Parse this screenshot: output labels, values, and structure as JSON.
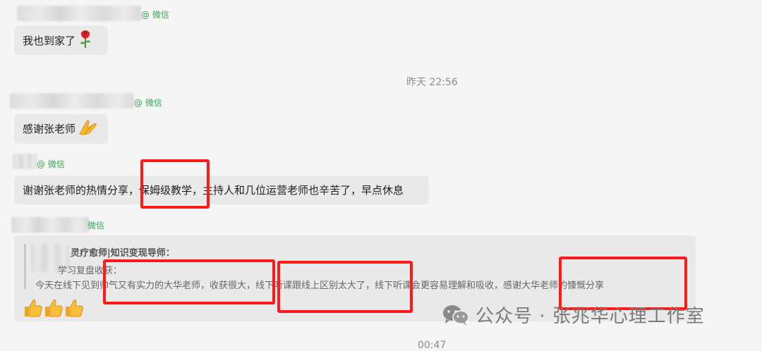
{
  "messages": [
    {
      "sender_tag": "@ 微信",
      "text": "我也到家了",
      "emoji": "rose-emoji"
    },
    {
      "sender_tag": "@ 微信",
      "text": "感谢张老师",
      "emoji": "praying-hands-emoji"
    },
    {
      "sender_tag": "@ 微信",
      "text": "谢谢张老师的热情分享，保姆级教学，主持人和几位运营老师也辛苦了，早点休息"
    },
    {
      "sender_tag": "微信"
    }
  ],
  "timestamp": "昨天 22:56",
  "quote": {
    "author_suffix": "灵疗愈师|知识变现导师：",
    "subject": "学习复盘收获：",
    "body": "今天在线下见到帅气又有实力的大华老师，收获很大，线下听课跟线上区别太大了，线下听课会更容易理解和吸收，感谢大华老师的慷慨分享",
    "reactions": [
      "thumbs-up-emoji",
      "thumbs-up-emoji",
      "thumbs-up-emoji"
    ]
  },
  "bottom_time_partial": "00:47",
  "watermark": {
    "text": "公众号 · 张兆华心理工作室",
    "icon": "wechat-logo-icon"
  },
  "colors": {
    "highlight": "#ff1a1a",
    "wechat_green": "#3aa557",
    "bubble": "#e9e9e9"
  }
}
